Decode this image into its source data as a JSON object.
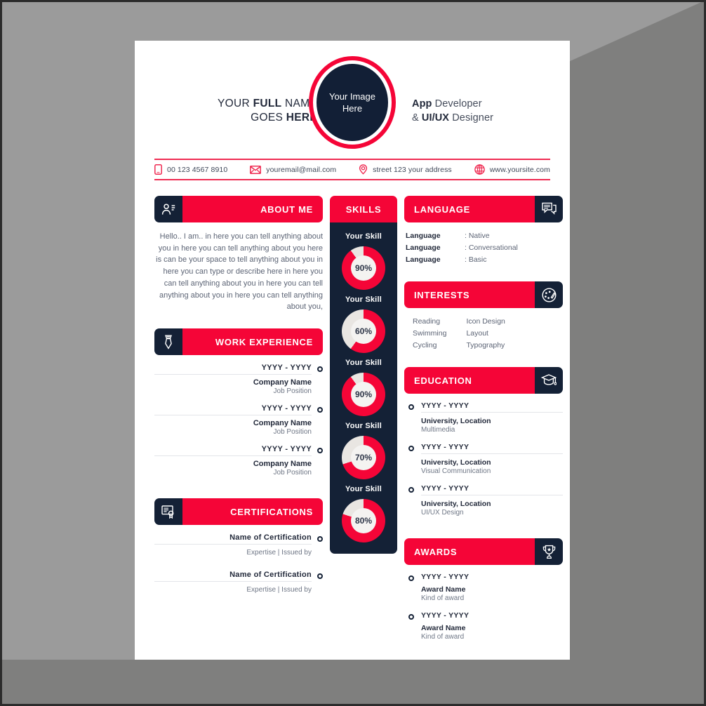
{
  "header": {
    "name_line1_pre": "YOUR ",
    "name_line1_bold": "FULL",
    "name_line1_post": " NAME",
    "name_line2_pre": "GOES ",
    "name_line2_bold": "HERE",
    "photo_placeholder_line1": "Your Image",
    "photo_placeholder_line2": "Here",
    "role_line1_bold": "App",
    "role_line1_post": " Developer",
    "role_line2_pre": "& ",
    "role_line2_bold": "UI/UX",
    "role_line2_post": " Designer"
  },
  "contact": [
    {
      "icon": "phone-icon",
      "text": "00 123 4567 8910"
    },
    {
      "icon": "email-icon",
      "text": "youremail@mail.com"
    },
    {
      "icon": "location-icon",
      "text": "street 123 your address"
    },
    {
      "icon": "globe-icon",
      "text": "www.yoursite.com"
    }
  ],
  "about": {
    "title": "ABOUT ME",
    "icon": "person-list-icon",
    "text": "Hello.. I am.. in here you can tell anything about you in here you can tell anything about you here is can be your space to tell anything about you in here you can type or describe here in here you can tell anything about you in here you can tell anything about you in here you can tell anything about you,"
  },
  "work": {
    "title": "WORK EXPERIENCE",
    "icon": "necktie-icon",
    "entries": [
      {
        "year": "YYYY - YYYY",
        "line1": "Company Name",
        "line2": "Job Position"
      },
      {
        "year": "YYYY - YYYY",
        "line1": "Company Name",
        "line2": "Job Position"
      },
      {
        "year": "YYYY - YYYY",
        "line1": "Company Name",
        "line2": "Job Position"
      }
    ]
  },
  "certifications": {
    "title": "CERTIFICATIONS",
    "icon": "certificate-icon",
    "entries": [
      {
        "name": "Name of Certification",
        "detail": "Expertise | Issued by"
      },
      {
        "name": "Name of Certification",
        "detail": "Expertise | Issued by"
      }
    ]
  },
  "skills": {
    "title": "SKILLS",
    "items": [
      {
        "label": "Your Skill",
        "percent": 90,
        "percent_text": "90%"
      },
      {
        "label": "Your Skill",
        "percent": 60,
        "percent_text": "60%"
      },
      {
        "label": "Your Skill",
        "percent": 90,
        "percent_text": "90%"
      },
      {
        "label": "Your Skill",
        "percent": 70,
        "percent_text": "70%"
      },
      {
        "label": "Your Skill",
        "percent": 80,
        "percent_text": "80%"
      }
    ]
  },
  "language": {
    "title": "LANGUAGE",
    "icon": "speech-bubble-icon",
    "rows": [
      {
        "key": "Language",
        "value": ": Native"
      },
      {
        "key": "Language",
        "value": ": Conversational"
      },
      {
        "key": "Language",
        "value": ": Basic"
      }
    ]
  },
  "interests": {
    "title": "INTERESTS",
    "icon": "palette-icon",
    "col1": [
      "Reading",
      "Swimming",
      "Cycling"
    ],
    "col2": [
      "Icon Design",
      "Layout",
      "Typography"
    ]
  },
  "education": {
    "title": "EDUCATION",
    "icon": "graduation-cap-icon",
    "entries": [
      {
        "year": "YYYY - YYYY",
        "line1": "University, Location",
        "line2": "Multimedia"
      },
      {
        "year": "YYYY - YYYY",
        "line1": "University, Location",
        "line2": "Visual Communication"
      },
      {
        "year": "YYYY - YYYY",
        "line1": "University, Location",
        "line2": "UI/UX Design"
      }
    ]
  },
  "awards": {
    "title": "AWARDS",
    "icon": "trophy-icon",
    "entries": [
      {
        "year": "YYYY - YYYY",
        "line1": "Award Name",
        "line2": "Kind of award"
      },
      {
        "year": "YYYY - YYYY",
        "line1": "Award Name",
        "line2": "Kind of award"
      }
    ]
  },
  "colors": {
    "accent_red": "#f50537",
    "dark_navy": "#142136",
    "contact_rule": "#ef2b52",
    "donut_track": "#e9e6e2",
    "page_bg": "#ffffff",
    "canvas_bg": "#9b9b9b",
    "shadow_bg": "#7f7f7e"
  }
}
